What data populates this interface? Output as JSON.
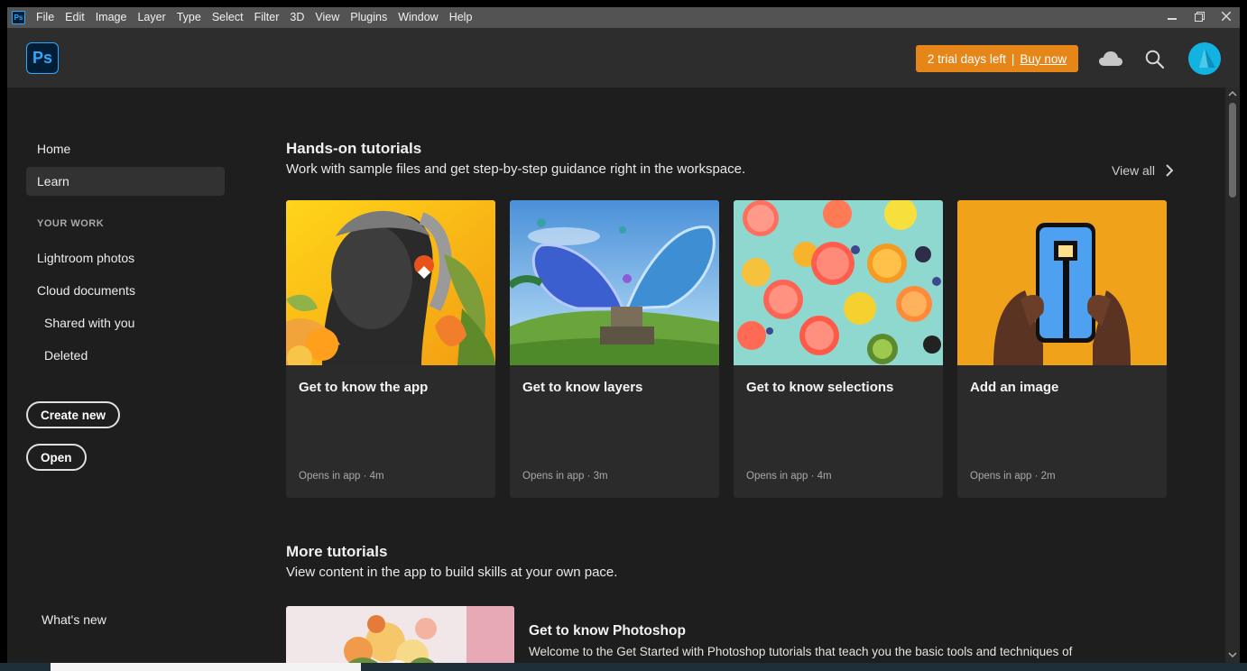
{
  "menubar": {
    "app_badge": "Ps",
    "items": [
      "File",
      "Edit",
      "Image",
      "Layer",
      "Type",
      "Select",
      "Filter",
      "3D",
      "View",
      "Plugins",
      "Window",
      "Help"
    ]
  },
  "topbar": {
    "logo": "Ps",
    "trial_text": "2 trial days left",
    "trial_separator": "|",
    "buy_now": "Buy now",
    "icons": [
      "cloud-icon",
      "search-icon",
      "avatar"
    ],
    "accent_color": "#e68619",
    "logo_color": "#31a8ff"
  },
  "sidebar": {
    "home": "Home",
    "learn": "Learn",
    "your_work_label": "YOUR WORK",
    "lightroom": "Lightroom photos",
    "cloud_docs": "Cloud documents",
    "shared": "Shared with you",
    "deleted": "Deleted",
    "create_new": "Create new",
    "open": "Open",
    "whats_new": "What's new",
    "active_item": "Learn"
  },
  "hands_on": {
    "title": "Hands-on tutorials",
    "subtitle": "Work with sample files and get step-by-step guidance right in the workspace.",
    "view_all": "View all",
    "cards": [
      {
        "title": "Get to know the app",
        "meta": "Opens in app  ·  4m"
      },
      {
        "title": "Get to know layers",
        "meta": "Opens in app  ·  3m"
      },
      {
        "title": "Get to know selections",
        "meta": "Opens in app  ·  4m"
      },
      {
        "title": "Add an image",
        "meta": "Opens in app  ·  2m"
      }
    ]
  },
  "more": {
    "title": "More tutorials",
    "subtitle": "View content in the app to build skills at your own pace.",
    "item_title": "Get to know Photoshop",
    "item_desc": "Welcome to the Get Started with Photoshop tutorials that teach you the basic tools and techniques of Adobe Photoshop. This tutorial introduces you to the Photoshop work area and shows you how to open and save your"
  }
}
